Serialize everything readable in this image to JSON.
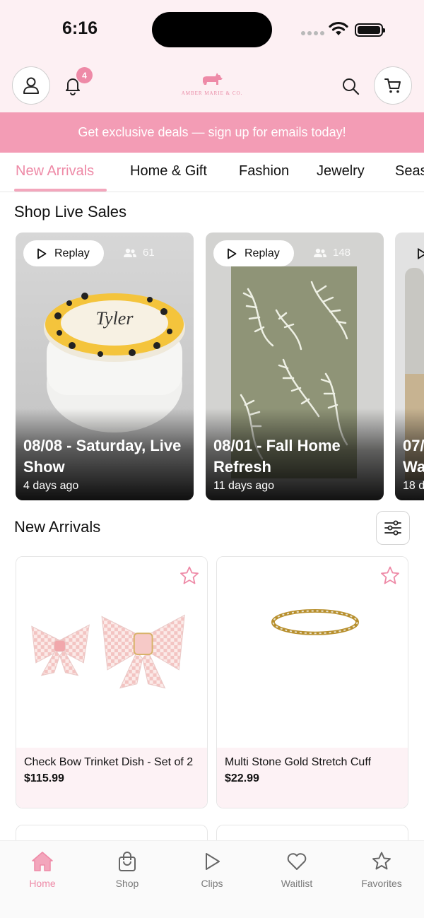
{
  "status_bar": {
    "time": "6:16"
  },
  "header": {
    "notification_count": "4",
    "logo_text": "AMBER MARIE & CO."
  },
  "promo": {
    "text": "Get exclusive deals — sign up for emails today!"
  },
  "tabs": [
    {
      "label": "New Arrivals",
      "active": true
    },
    {
      "label": "Home & Gift"
    },
    {
      "label": "Fashion"
    },
    {
      "label": "Jewelry"
    },
    {
      "label": "Seas"
    }
  ],
  "live_sales": {
    "title": "Shop Live Sales",
    "items": [
      {
        "replay_label": "Replay",
        "viewers": "61",
        "title": "08/08 - Saturday, Live Show",
        "ago": "4 days ago"
      },
      {
        "replay_label": "Replay",
        "viewers": "148",
        "title": "08/01 - Fall Home Refresh",
        "ago": "11 days ago"
      },
      {
        "title": "07/",
        "title2": "Wa",
        "ago": "18 d"
      }
    ]
  },
  "new_arrivals": {
    "title": "New Arrivals",
    "products": [
      {
        "name": "Check Bow Trinket Dish - Set of 2",
        "price": "$115.99"
      },
      {
        "name": "Multi Stone Gold Stretch Cuff",
        "price": "$22.99"
      }
    ]
  },
  "bottom_nav": [
    {
      "label": "Home",
      "icon": "home-icon",
      "active": true
    },
    {
      "label": "Shop",
      "icon": "shopping-bag-icon"
    },
    {
      "label": "Clips",
      "icon": "play-icon"
    },
    {
      "label": "Waitlist",
      "icon": "heart-icon"
    },
    {
      "label": "Favorites",
      "icon": "star-icon"
    }
  ],
  "colors": {
    "accent": "#ee8aa7",
    "promo_bg": "#f39cb5",
    "header_bg": "#fdf0f3"
  }
}
